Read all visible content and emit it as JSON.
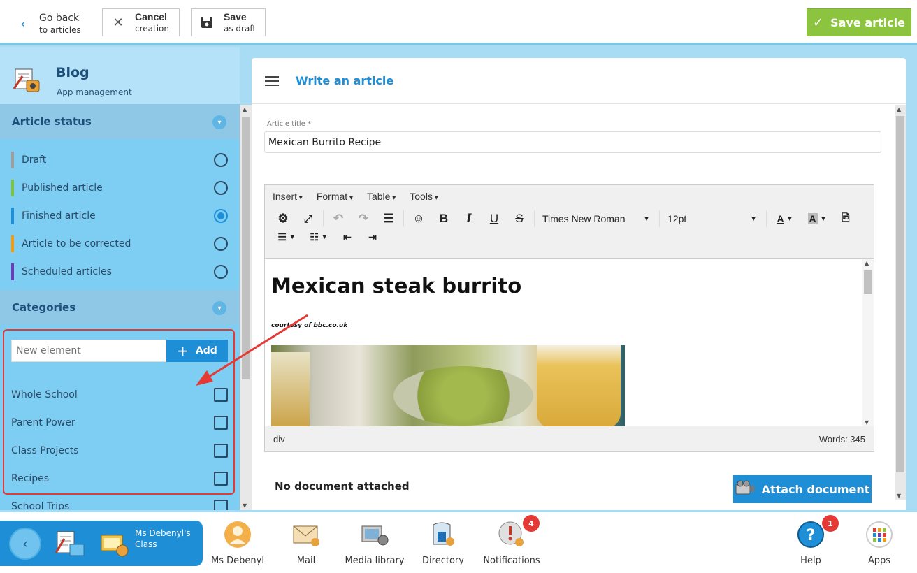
{
  "topbar": {
    "back": {
      "line1": "Go back",
      "line2": "to articles"
    },
    "cancel": {
      "line1": "Cancel",
      "line2": "creation"
    },
    "save": {
      "line1": "Save",
      "line2": "as draft"
    },
    "save_article": "Save article"
  },
  "app": {
    "title": "Blog",
    "subtitle": "App management"
  },
  "article_status": {
    "heading": "Article status",
    "items": [
      {
        "label": "Draft",
        "color": "#9e9e9e",
        "selected": false
      },
      {
        "label": "Published article",
        "color": "#7cc243",
        "selected": false
      },
      {
        "label": "Finished article",
        "color": "#1e8ed6",
        "selected": true
      },
      {
        "label": "Article to be corrected",
        "color": "#f39c12",
        "selected": false
      },
      {
        "label": "Scheduled articles",
        "color": "#6a3fb5",
        "selected": false
      }
    ]
  },
  "categories": {
    "heading": "Categories",
    "new_placeholder": "New element",
    "add_label": "Add",
    "items": [
      "Whole School",
      "Parent Power",
      "Class Projects",
      "Recipes",
      "School Trips"
    ]
  },
  "main": {
    "title": "Write an article",
    "title_label": "Article title *",
    "title_value": "Mexican Burrito Recipe",
    "menus": [
      "Insert",
      "Format",
      "Table",
      "Tools"
    ],
    "font_name": "Times New Roman",
    "font_size": "12pt",
    "content_heading": "Mexican steak burrito",
    "content_credit": "courtesy of bbc.co.uk",
    "status_path": "div",
    "word_count": "Words: 345",
    "no_doc": "No document attached",
    "attach": "Attach document"
  },
  "taskbar": {
    "class_name": "Ms Debenyl's Class",
    "items": [
      {
        "label": "Ms Debenyl"
      },
      {
        "label": "Mail"
      },
      {
        "label": "Media library"
      },
      {
        "label": "Directory"
      },
      {
        "label": "Notifications",
        "badge": "4"
      },
      {
        "label": "Help",
        "badge": "1"
      },
      {
        "label": "Apps"
      }
    ]
  }
}
